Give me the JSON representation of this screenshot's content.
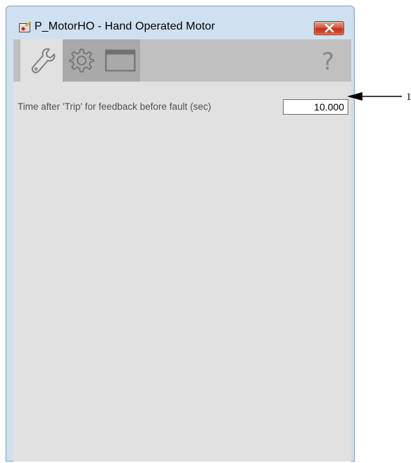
{
  "window": {
    "title": "P_MotorHO - Hand Operated Motor",
    "close_icon": "close-icon"
  },
  "toolbar": {
    "tabs": [
      {
        "icon": "wrench-icon",
        "selected": true
      },
      {
        "icon": "gear-icon",
        "selected": false
      },
      {
        "icon": "faceplate-icon",
        "selected": false
      }
    ],
    "help_label": "?"
  },
  "settings": {
    "fault_time_label": "Time after 'Trip' for feedback before fault (sec)",
    "fault_time_value": "10.000"
  },
  "annotation": {
    "letter": "1"
  },
  "colors": {
    "toolbar_bg": "#c0c0c0",
    "selected_tab_bg": "#e1e1e1",
    "unselected_tab_bg": "#a9a9a9",
    "client_bg": "#e1e1e1",
    "frame": "#cfe0f1",
    "close_button": "#c2331b"
  }
}
